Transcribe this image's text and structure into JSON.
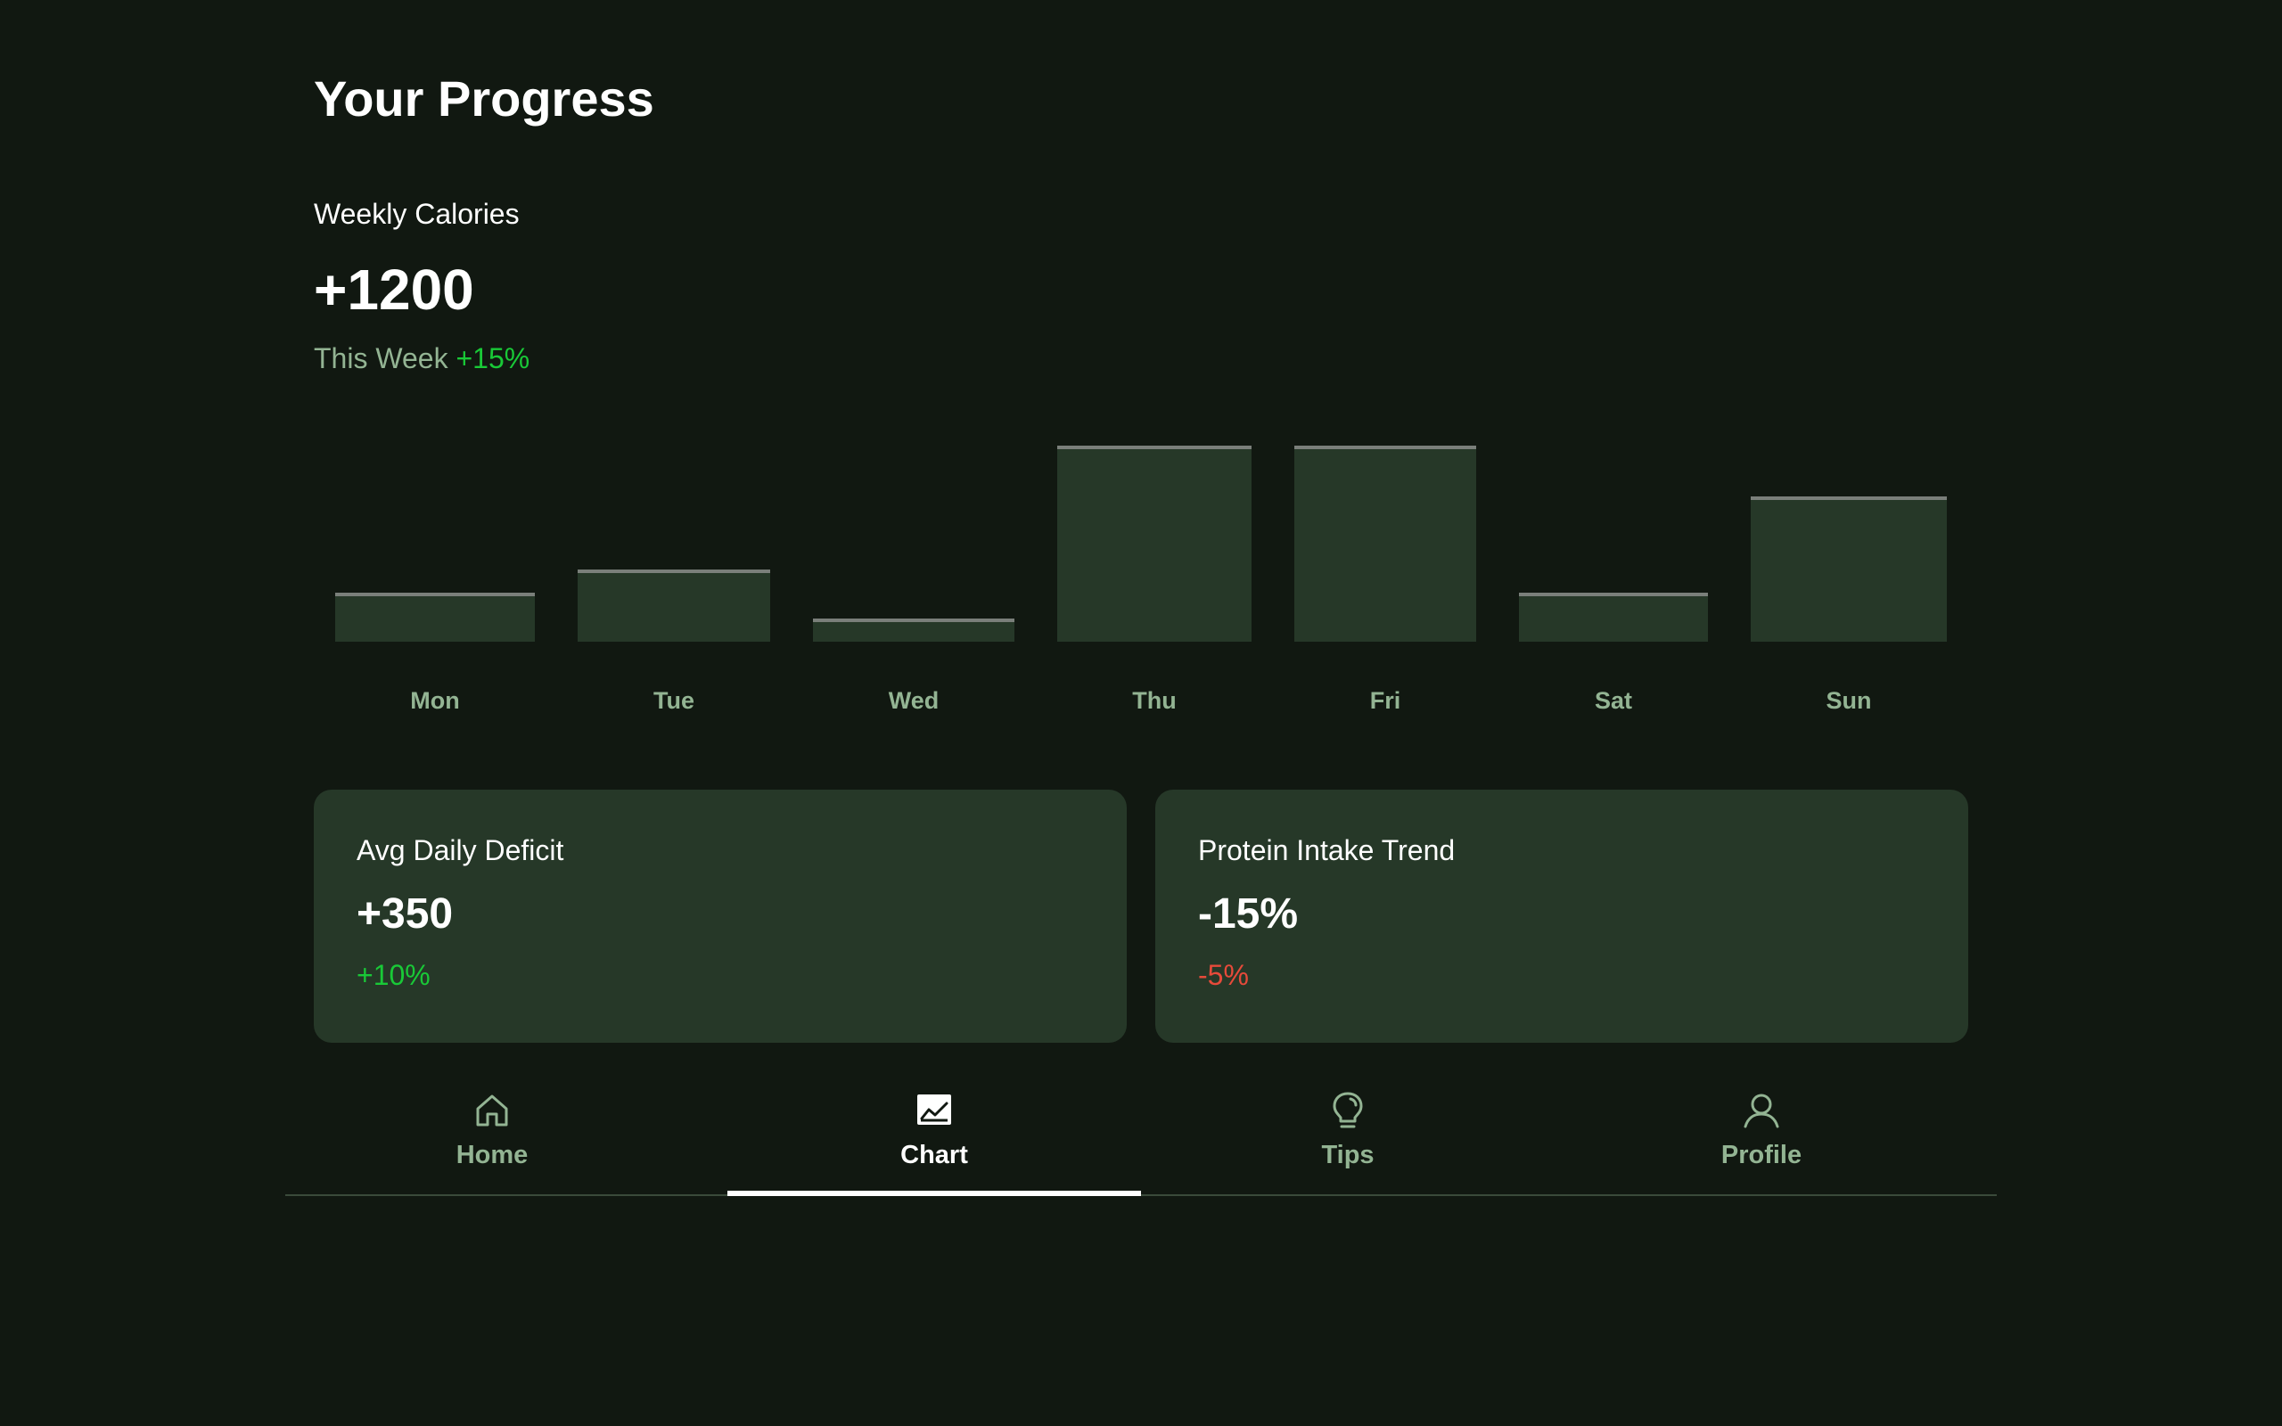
{
  "header": {
    "title": "Your Progress"
  },
  "weekly": {
    "label": "Weekly Calories",
    "value": "+1200",
    "period": "This Week",
    "change": "+15%"
  },
  "chart_data": {
    "type": "bar",
    "categories": [
      "Mon",
      "Tue",
      "Wed",
      "Thu",
      "Fri",
      "Sat",
      "Sun"
    ],
    "values": [
      25,
      37,
      12,
      100,
      100,
      25,
      74
    ],
    "colors": {
      "bar": "#263828",
      "cap": "#7a7f7a"
    }
  },
  "cards": [
    {
      "title": "Avg Daily Deficit",
      "value": "+350",
      "change": "+10%",
      "trend": "positive"
    },
    {
      "title": "Protein Intake Trend",
      "value": "-15%",
      "change": "-5%",
      "trend": "negative"
    }
  ],
  "nav": {
    "items": [
      {
        "label": "Home",
        "icon": "home-icon",
        "active": false
      },
      {
        "label": "Chart",
        "icon": "chart-icon",
        "active": true
      },
      {
        "label": "Tips",
        "icon": "lightbulb-icon",
        "active": false
      },
      {
        "label": "Profile",
        "icon": "user-icon",
        "active": false
      }
    ]
  },
  "colors": {
    "background": "#111811",
    "positive": "#19c937",
    "negative": "#e64a3a",
    "muted": "#93b493",
    "card": "#263828"
  }
}
